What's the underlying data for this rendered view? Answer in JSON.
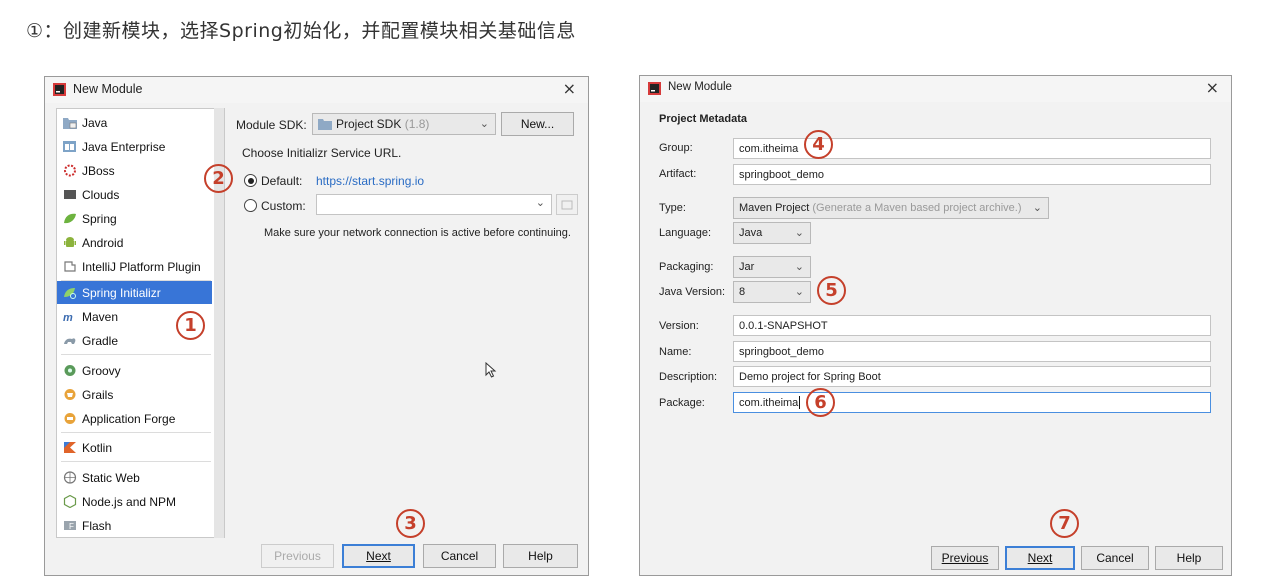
{
  "heading": "①：创建新模块，选择Spring初始化，并配置模块相关基础信息",
  "dialog1": {
    "title": "New Module",
    "close": "×",
    "project_types": [
      {
        "label": "Java",
        "icon": "java-folder-icon"
      },
      {
        "label": "Java Enterprise",
        "icon": "java-enterprise-icon"
      },
      {
        "label": "JBoss",
        "icon": "jboss-icon"
      },
      {
        "label": "Clouds",
        "icon": "clouds-icon"
      },
      {
        "label": "Spring",
        "icon": "spring-leaf-icon"
      },
      {
        "label": "Android",
        "icon": "android-icon"
      },
      {
        "label": "IntelliJ Platform Plugin",
        "icon": "plugin-icon"
      },
      {
        "label": "Spring Initializr",
        "icon": "spring-initializr-icon"
      },
      {
        "label": "Maven",
        "icon": "maven-icon"
      },
      {
        "label": "Gradle",
        "icon": "gradle-icon"
      },
      {
        "label": "Groovy",
        "icon": "groovy-icon"
      },
      {
        "label": "Grails",
        "icon": "grails-icon"
      },
      {
        "label": "Application Forge",
        "icon": "application-forge-icon"
      },
      {
        "label": "Kotlin",
        "icon": "kotlin-icon"
      },
      {
        "label": "Static Web",
        "icon": "static-web-icon"
      },
      {
        "label": "Node.js and NPM",
        "icon": "nodejs-icon"
      },
      {
        "label": "Flash",
        "icon": "flash-icon"
      }
    ],
    "selected": "Spring Initializr",
    "sdk_label": "Module SDK:",
    "sdk_value": "Project SDK",
    "sdk_version": "(1.8)",
    "new_button": "New...",
    "service_url_label": "Choose Initializr Service URL.",
    "default_label": "Default:",
    "default_url": "https://start.spring.io",
    "custom_label": "Custom:",
    "custom_value": "",
    "network_note": "Make sure your network connection is active before continuing.",
    "buttons": {
      "previous": "Previous",
      "next": "Next",
      "cancel": "Cancel",
      "help": "Help"
    }
  },
  "dialog2": {
    "title": "New Module",
    "close": "×",
    "section": "Project Metadata",
    "group_label": "Group:",
    "group_value": "com.itheima",
    "artifact_label": "Artifact:",
    "artifact_value": "springboot_demo",
    "type_label": "Type:",
    "type_value": "Maven Project",
    "type_hint": "(Generate a Maven based project archive.)",
    "language_label": "Language:",
    "language_value": "Java",
    "packaging_label": "Packaging:",
    "packaging_value": "Jar",
    "java_version_label": "Java Version:",
    "java_version_value": "8",
    "version_label": "Version:",
    "version_value": "0.0.1-SNAPSHOT",
    "name_label": "Name:",
    "name_value": "springboot_demo",
    "description_label": "Description:",
    "description_value": "Demo project for Spring Boot",
    "package_label": "Package:",
    "package_value": "com.itheima",
    "buttons": {
      "previous": "Previous",
      "next": "Next",
      "cancel": "Cancel",
      "help": "Help"
    }
  },
  "markers": [
    "1",
    "2",
    "3",
    "4",
    "5",
    "6",
    "7"
  ],
  "colors": {
    "marker": "#c5402b",
    "selection": "#3875d7",
    "link": "#2a6cc4"
  }
}
